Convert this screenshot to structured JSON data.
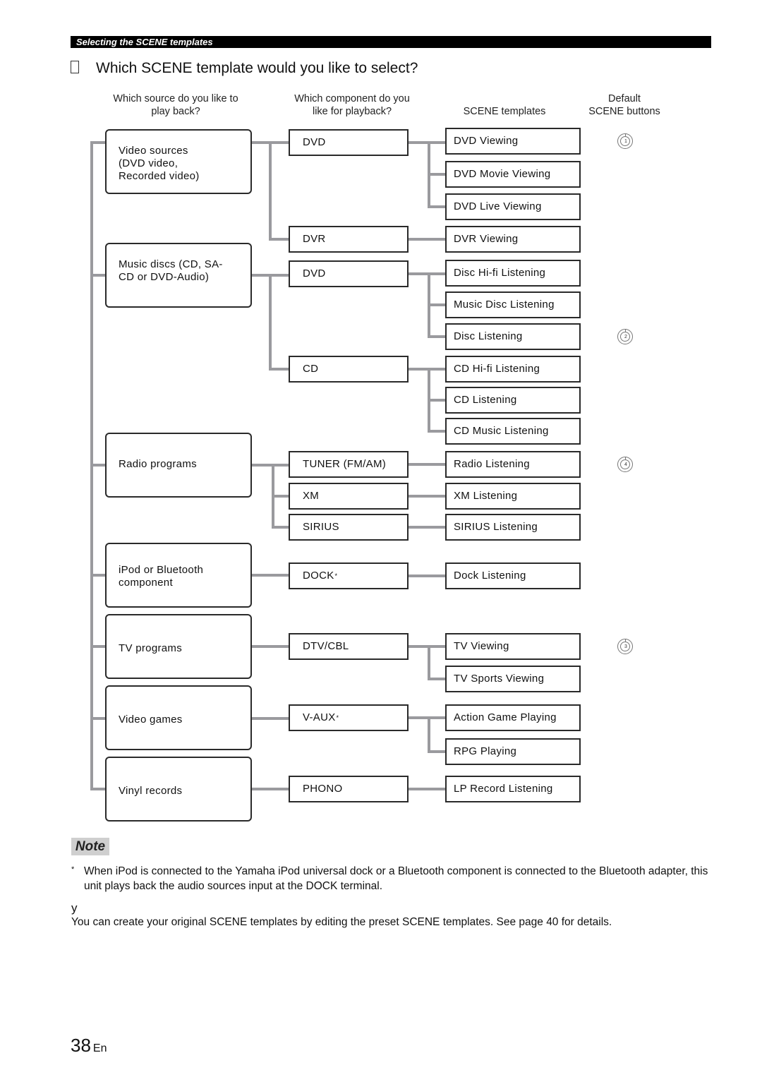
{
  "section_header": "Selecting the SCENE templates",
  "title": "Which SCENE template would you like to select?",
  "column_headers": {
    "source": [
      "Which source do you like to",
      "play back?"
    ],
    "component": [
      "Which component do you",
      "like for playback?"
    ],
    "templates": [
      "SCENE templates"
    ],
    "buttons": [
      "Default",
      "SCENE buttons"
    ]
  },
  "sources": [
    {
      "lines": [
        "Video sources",
        "(DVD video,",
        "Recorded video)"
      ]
    },
    {
      "lines": [
        "Music discs (CD, SA-",
        "CD or DVD-Audio)"
      ]
    },
    {
      "lines": [
        "Radio programs"
      ]
    },
    {
      "lines": [
        "iPod or Bluetooth",
        "component"
      ]
    },
    {
      "lines": [
        "TV programs"
      ]
    },
    {
      "lines": [
        "Video games"
      ]
    },
    {
      "lines": [
        "Vinyl records"
      ]
    }
  ],
  "components": [
    {
      "label": "DVD",
      "source": 0
    },
    {
      "label": "DVR",
      "source": 0
    },
    {
      "label": "DVD",
      "source": 1
    },
    {
      "label": "CD",
      "source": 1
    },
    {
      "label": "TUNER (FM/AM)",
      "source": 2
    },
    {
      "label": "XM",
      "source": 2
    },
    {
      "label": "SIRIUS",
      "source": 2
    },
    {
      "label": "DOCK",
      "sup": "*",
      "source": 3
    },
    {
      "label": "DTV/CBL",
      "source": 4
    },
    {
      "label": "V-AUX",
      "sup": "*",
      "source": 5
    },
    {
      "label": "PHONO",
      "source": 6
    }
  ],
  "templates": [
    {
      "label": "DVD Viewing",
      "component": 0,
      "scene_button": "1"
    },
    {
      "label": "DVD Movie Viewing",
      "component": 0
    },
    {
      "label": "DVD Live Viewing",
      "component": 0
    },
    {
      "label": "DVR Viewing",
      "component": 1
    },
    {
      "label": "Disc Hi-fi Listening",
      "component": 2
    },
    {
      "label": "Music Disc Listening",
      "component": 2
    },
    {
      "label": "Disc Listening",
      "component": 2,
      "scene_button": "2"
    },
    {
      "label": "CD Hi-fi Listening",
      "component": 3
    },
    {
      "label": "CD Listening",
      "component": 3
    },
    {
      "label": "CD Music Listening",
      "component": 3
    },
    {
      "label": "Radio Listening",
      "component": 4,
      "scene_button": "4"
    },
    {
      "label": "XM Listening",
      "component": 5
    },
    {
      "label": "SIRIUS Listening",
      "component": 6
    },
    {
      "label": "Dock Listening",
      "component": 7
    },
    {
      "label": "TV Viewing",
      "component": 8,
      "scene_button": "3"
    },
    {
      "label": "TV Sports Viewing",
      "component": 8
    },
    {
      "label": "Action Game Playing",
      "component": 9
    },
    {
      "label": "RPG Playing",
      "component": 9
    },
    {
      "label": "LP Record Listening",
      "component": 10
    }
  ],
  "note": {
    "tag": "Note",
    "asterisk": "*",
    "text": "When iPod is connected to the Yamaha iPod universal dock or a Bluetooth component is connected to the Bluetooth adapter, this unit plays back the audio sources input at the DOCK terminal."
  },
  "tip": {
    "icon": "y",
    "text": "You can create your original SCENE templates by editing the preset SCENE templates. See page 40 for details."
  },
  "page": {
    "number": "38",
    "lang": "En"
  }
}
